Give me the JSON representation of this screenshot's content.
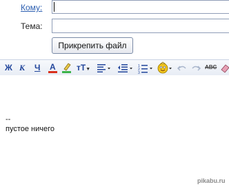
{
  "header": {
    "to_label": "Кому:",
    "to_value": "",
    "subject_label": "Тема:",
    "subject_value": "",
    "attach_label": "Прикрепить файл"
  },
  "toolbar": {
    "bold": "Ж",
    "italic": "К",
    "underline": "Ч",
    "font_color": "A",
    "font_size": "тТ",
    "strikethrough": "ABC"
  },
  "body": {
    "signature_dashes": "--",
    "signature_text": "пустое ничего"
  },
  "watermark": "pikabu.ru",
  "colors": {
    "link": "#2a5db0",
    "toolbar_icon": "#23479c",
    "font_color_bar": "#d9301c",
    "highlight_bar": "#3bb34a"
  }
}
